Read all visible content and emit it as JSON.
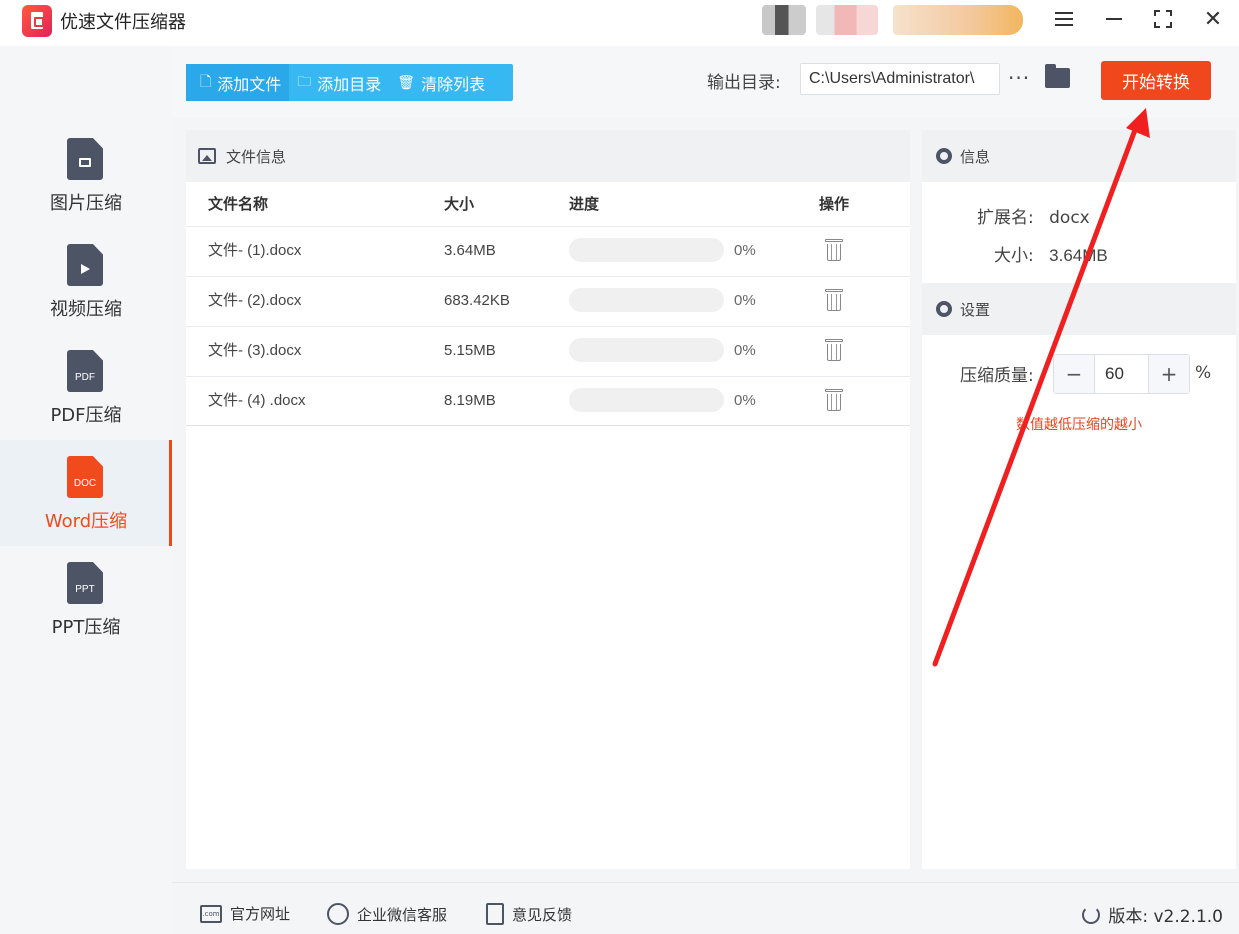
{
  "app": {
    "title": "优速文件压缩器"
  },
  "sidebar": {
    "items": [
      {
        "label": "图片压缩",
        "icon": "image-file-icon",
        "active": false
      },
      {
        "label": "视频压缩",
        "icon": "video-file-icon",
        "active": false
      },
      {
        "label": "PDF压缩",
        "icon_text": "PDF",
        "active": false
      },
      {
        "label": "Word压缩",
        "icon_text": "DOC",
        "active": true
      },
      {
        "label": "PPT压缩",
        "icon_text": "PPT",
        "active": false
      }
    ]
  },
  "toolbar": {
    "add_file": "添加文件",
    "add_folder": "添加目录",
    "clear_list": "清除列表",
    "output_label": "输出目录:",
    "output_path": "C:\\Users\\Administrator\\",
    "more": "···",
    "start": "开始转换"
  },
  "file_panel": {
    "title": "文件信息",
    "columns": [
      "文件名称",
      "大小",
      "进度",
      "操作"
    ],
    "rows": [
      {
        "name": "文件- (1).docx",
        "size": "3.64MB",
        "progress": 0,
        "progress_text": "0%"
      },
      {
        "name": "文件- (2).docx",
        "size": "683.42KB",
        "progress": 0,
        "progress_text": "0%"
      },
      {
        "name": "文件- (3).docx",
        "size": "5.15MB",
        "progress": 0,
        "progress_text": "0%"
      },
      {
        "name": "文件- (4) .docx",
        "size": "8.19MB",
        "progress": 0,
        "progress_text": "0%"
      }
    ]
  },
  "info_panel": {
    "title": "信息",
    "ext_label": "扩展名:",
    "ext_value": "docx",
    "size_label": "大小:",
    "size_value": "3.64MB"
  },
  "settings_panel": {
    "title": "设置",
    "quality_label": "压缩质量:",
    "minus": "−",
    "quality_value": "60",
    "plus": "+",
    "unit": "%",
    "hint": "数值越低压缩的越小"
  },
  "footer": {
    "website": "官方网址",
    "wechat": "企业微信客服",
    "feedback": "意见反馈",
    "version": "版本: v2.2.1.0",
    "web_icon_text": ".com"
  },
  "colors": {
    "accent": "#f0471d",
    "toolbar_blue": "#38b8f2",
    "icon_gray": "#4d5466"
  }
}
